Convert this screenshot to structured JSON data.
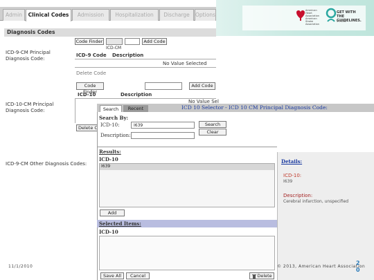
{
  "tabs": [
    {
      "label": "Admin",
      "active": false
    },
    {
      "label": "Clinical Codes",
      "active": true
    },
    {
      "label": "Admission",
      "active": false
    },
    {
      "label": "Hospitalization",
      "active": false
    },
    {
      "label": "Discharge",
      "active": false
    },
    {
      "label": "Options",
      "active": false
    }
  ],
  "diagnosis": {
    "header": "Diagnosis Codes",
    "icd9_principal_label": "ICD-9-CM Principal\nDiagnosis Code:",
    "code_finder": "Code Finder",
    "add_code": "Add Code",
    "icd_cm_label": "ICD-CM",
    "icd9_code_col": "ICD-9 Code",
    "description_col": "Description",
    "no_value": "No Value Selected",
    "delete_code": "Delete Code",
    "icd10_principal_label": "ICD-10-CM Principal\nDiagnosis Code:",
    "icd10_col": "ICD-10",
    "description_col2": "Description",
    "no_value_short": "No Value Sel",
    "delete_partial": "Delete C",
    "icd9_other_label": "ICD-9-CM Other Diagnosis Codes:"
  },
  "dialog": {
    "tab_search": "Search",
    "tab_recent": "Recent",
    "title": "ICD 10 Selector - ICD 10 CM Principal Diagnosis Code:",
    "search_by": "Search By:",
    "icd10_label": "ICD-10:",
    "icd10_value": "I639",
    "description_label": "Description:",
    "description_value": "",
    "search_button": "Search",
    "clear_button": "Clear",
    "results_label": "Results:",
    "results_col": "ICD-10",
    "results": [
      "I639"
    ],
    "add_button": "Add",
    "selected_label": "Selected Items:",
    "selected_col": "ICD-10",
    "save_all_button": "Save All",
    "cancel_button": "Cancel",
    "delete_button": "Delete"
  },
  "details": {
    "title": "Details:",
    "code_label": "ICD-10:",
    "code_value": "I639",
    "desc_label": "Description:",
    "desc_value": "Cerebral infarction, unspecified"
  },
  "logo": {
    "aha_text": "American Heart Association American Stroke Association",
    "gwtg_text": "GET WITH THE GUIDELINES.",
    "stroke_text": "STROKE"
  },
  "footer": {
    "date": "11/1/2010",
    "copyright": "© 2013, American Heart Association",
    "page_number": "20"
  }
}
